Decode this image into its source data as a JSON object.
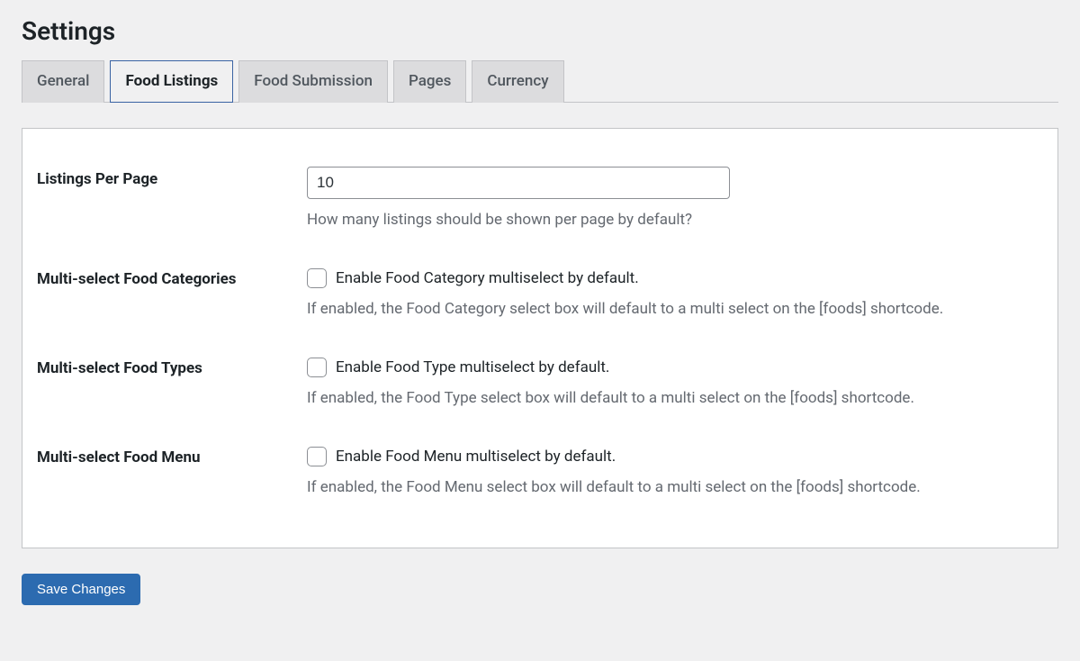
{
  "page": {
    "title": "Settings"
  },
  "tabs": [
    {
      "label": "General"
    },
    {
      "label": "Food Listings"
    },
    {
      "label": "Food Submission"
    },
    {
      "label": "Pages"
    },
    {
      "label": "Currency"
    }
  ],
  "active_tab_index": 1,
  "fields": {
    "listings_per_page": {
      "label": "Listings Per Page",
      "value": "10",
      "description": "How many listings should be shown per page by default?"
    },
    "multi_categories": {
      "label": "Multi-select Food Categories",
      "checkbox_label": "Enable Food Category multiselect by default.",
      "description": "If enabled, the Food Category select box will default to a multi select on the [foods] shortcode.",
      "checked": false
    },
    "multi_types": {
      "label": "Multi-select Food Types",
      "checkbox_label": "Enable Food Type multiselect by default.",
      "description": "If enabled, the Food Type select box will default to a multi select on the [foods] shortcode.",
      "checked": false
    },
    "multi_menu": {
      "label": "Multi-select Food Menu",
      "checkbox_label": "Enable Food Menu multiselect by default.",
      "description": "If enabled, the Food Menu select box will default to a multi select on the [foods] shortcode.",
      "checked": false
    }
  },
  "buttons": {
    "save": "Save Changes"
  }
}
